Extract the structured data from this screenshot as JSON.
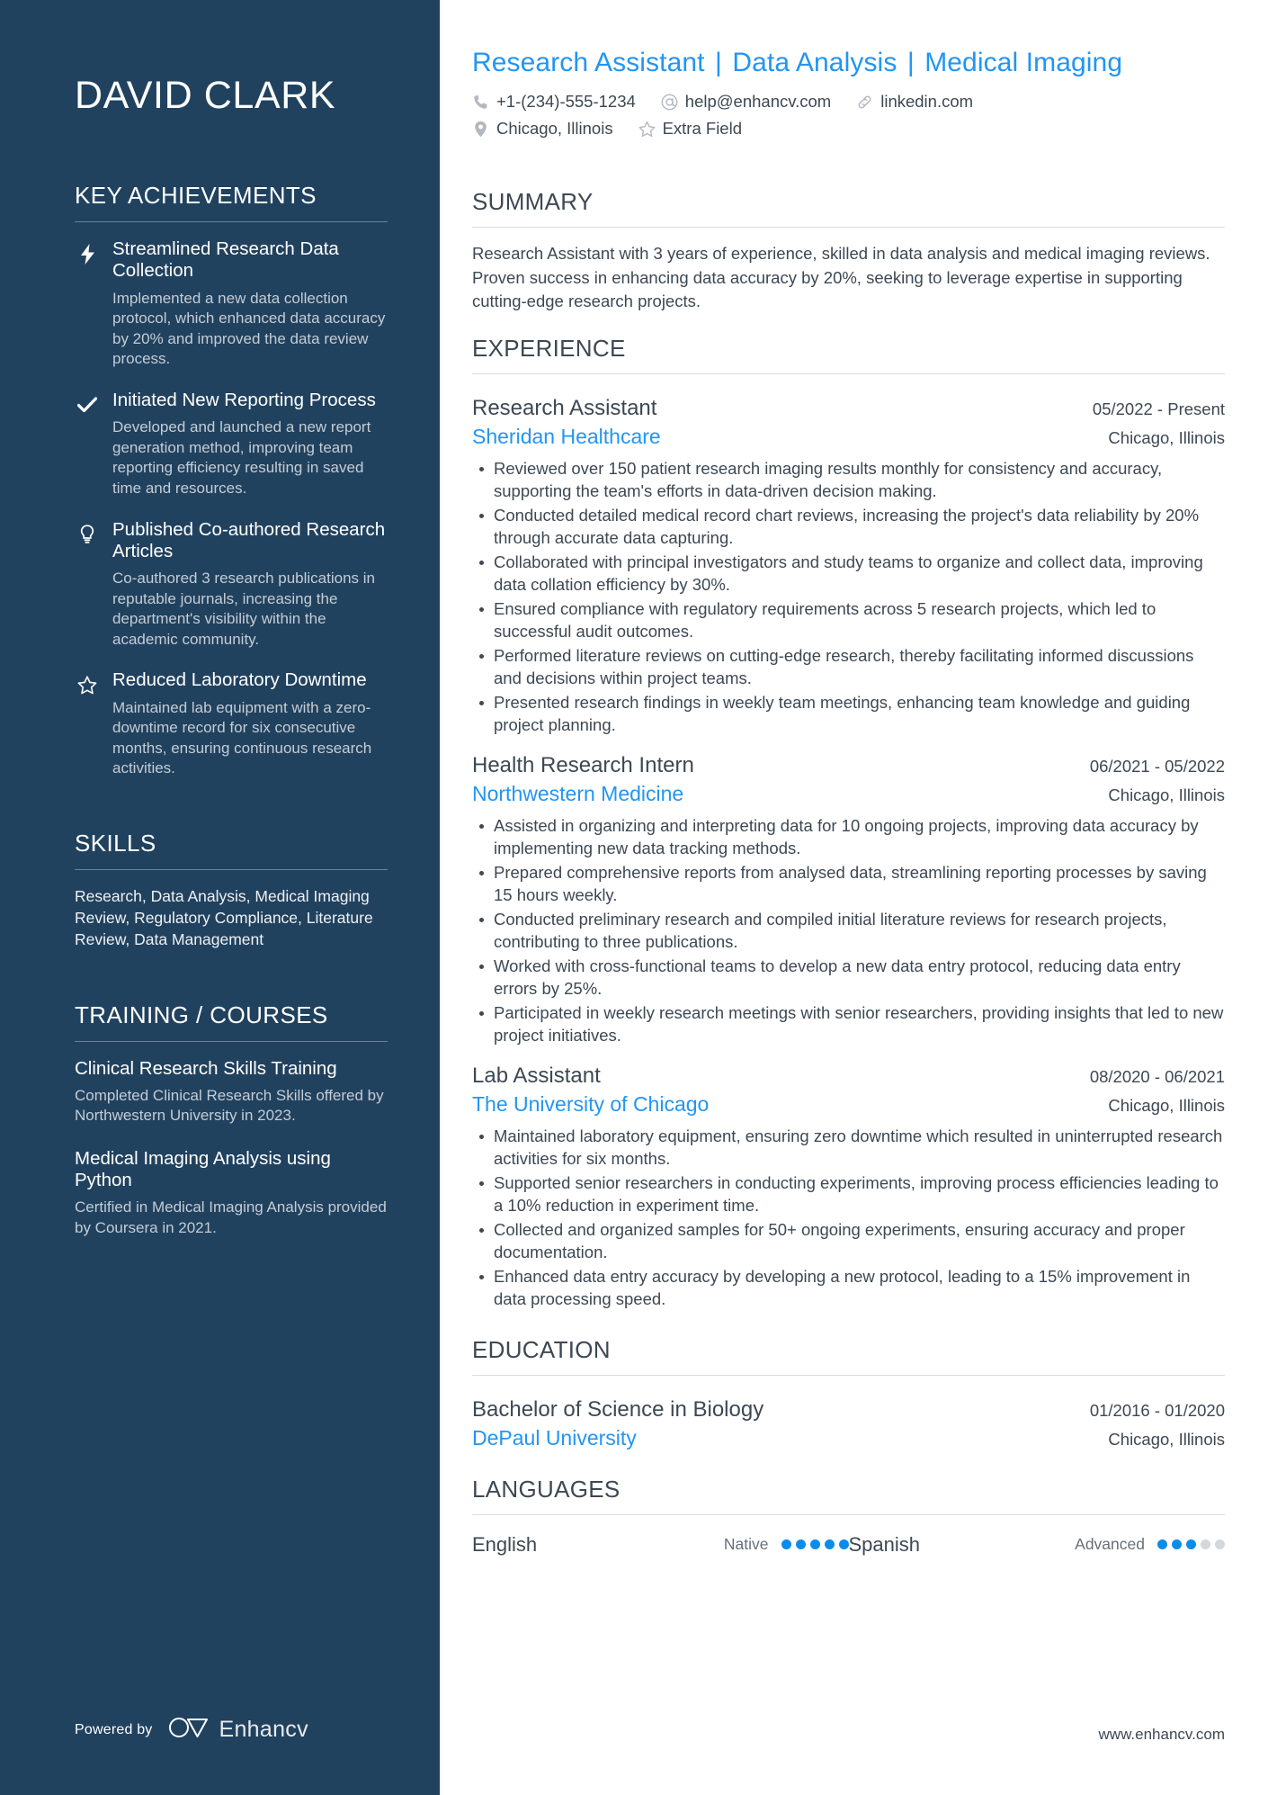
{
  "sidebar": {
    "name": "DAVID CLARK",
    "achievements_heading": "KEY ACHIEVEMENTS",
    "achievements": [
      {
        "icon": "lightning-bolt-icon",
        "title": "Streamlined Research Data Collection",
        "desc": "Implemented a new data collection protocol, which enhanced data accuracy by 20% and improved the data review process."
      },
      {
        "icon": "check-mark-icon",
        "title": "Initiated New Reporting Process",
        "desc": "Developed and launched a new report generation method, improving team reporting efficiency resulting in saved time and resources."
      },
      {
        "icon": "lightbulb-icon",
        "title": "Published Co-authored Research Articles",
        "desc": "Co-authored 3 research publications in reputable journals, increasing the department's visibility within the academic community."
      },
      {
        "icon": "star-outline-icon",
        "title": "Reduced Laboratory Downtime",
        "desc": "Maintained lab equipment with a zero-downtime record for six consecutive months, ensuring continuous research activities."
      }
    ],
    "skills_heading": "SKILLS",
    "skills_text": "Research, Data Analysis, Medical Imaging Review, Regulatory Compliance, Literature Review, Data Management",
    "training_heading": "TRAINING / COURSES",
    "courses": [
      {
        "title": "Clinical Research Skills Training",
        "desc": "Completed Clinical Research Skills offered by Northwestern University in 2023."
      },
      {
        "title": "Medical Imaging Analysis using Python",
        "desc": "Certified in Medical Imaging Analysis provided by Coursera in 2021."
      }
    ],
    "powered_by_label": "Powered by",
    "brand_name": "Enhancv"
  },
  "header": {
    "headline_parts": [
      "Research Assistant",
      "Data Analysis",
      "Medical Imaging"
    ],
    "headline_separator": "|",
    "contacts_row1": [
      {
        "icon": "phone-icon",
        "text": "+1-(234)-555-1234"
      },
      {
        "icon": "at-sign-icon",
        "text": "help@enhancv.com"
      },
      {
        "icon": "link-icon",
        "text": "linkedin.com"
      }
    ],
    "contacts_row2": [
      {
        "icon": "map-pin-icon",
        "text": "Chicago, Illinois"
      },
      {
        "icon": "star-outline-icon",
        "text": "Extra Field"
      }
    ]
  },
  "summary": {
    "heading": "SUMMARY",
    "text": "Research Assistant with 3 years of experience, skilled in data analysis and medical imaging reviews. Proven success in enhancing data accuracy by 20%, seeking to leverage expertise in supporting cutting-edge research projects."
  },
  "experience": {
    "heading": "EXPERIENCE",
    "entries": [
      {
        "title": "Research Assistant",
        "date": "05/2022 - Present",
        "org": "Sheridan Healthcare",
        "location": "Chicago, Illinois",
        "bullets": [
          "Reviewed over 150 patient research imaging results monthly for consistency and accuracy, supporting the team's efforts in data-driven decision making.",
          "Conducted detailed medical record chart reviews, increasing the project's data reliability by 20% through accurate data capturing.",
          "Collaborated with principal investigators and study teams to organize and collect data, improving data collation efficiency by 30%.",
          "Ensured compliance with regulatory requirements across 5 research projects, which led to successful audit outcomes.",
          "Performed literature reviews on cutting-edge research, thereby facilitating informed discussions and decisions within project teams.",
          "Presented research findings in weekly team meetings, enhancing team knowledge and guiding project planning."
        ]
      },
      {
        "title": "Health Research Intern",
        "date": "06/2021 - 05/2022",
        "org": "Northwestern Medicine",
        "location": "Chicago, Illinois",
        "bullets": [
          "Assisted in organizing and interpreting data for 10 ongoing projects, improving data accuracy by implementing new data tracking methods.",
          "Prepared comprehensive reports from analysed data, streamlining reporting processes by saving 15 hours weekly.",
          "Conducted preliminary research and compiled initial literature reviews for research projects, contributing to three publications.",
          "Worked with cross-functional teams to develop a new data entry protocol, reducing data entry errors by 25%.",
          "Participated in weekly research meetings with senior researchers, providing insights that led to new project initiatives."
        ]
      },
      {
        "title": "Lab Assistant",
        "date": "08/2020 - 06/2021",
        "org": "The University of Chicago",
        "location": "Chicago, Illinois",
        "bullets": [
          "Maintained laboratory equipment, ensuring zero downtime which resulted in uninterrupted research activities for six months.",
          "Supported senior researchers in conducting experiments, improving process efficiencies leading to a 10% reduction in experiment time.",
          "Collected and organized samples for 50+ ongoing experiments, ensuring accuracy and proper documentation.",
          "Enhanced data entry accuracy by developing a new protocol, leading to a 15% improvement in data processing speed."
        ]
      }
    ]
  },
  "education": {
    "heading": "EDUCATION",
    "entries": [
      {
        "title": "Bachelor of Science in Biology",
        "date": "01/2016 - 01/2020",
        "org": "DePaul University",
        "location": "Chicago, Illinois"
      }
    ]
  },
  "languages": {
    "heading": "LANGUAGES",
    "items": [
      {
        "name": "English",
        "level": "Native",
        "filled": 5,
        "total": 5
      },
      {
        "name": "Spanish",
        "level": "Advanced",
        "filled": 3,
        "total": 5
      }
    ]
  },
  "footer": {
    "url": "www.enhancv.com"
  },
  "colors": {
    "sidebar_bg": "#21425e",
    "accent_blue": "#2196f3",
    "dot_blue": "#0c8ce9",
    "body_text": "#3d4853"
  }
}
